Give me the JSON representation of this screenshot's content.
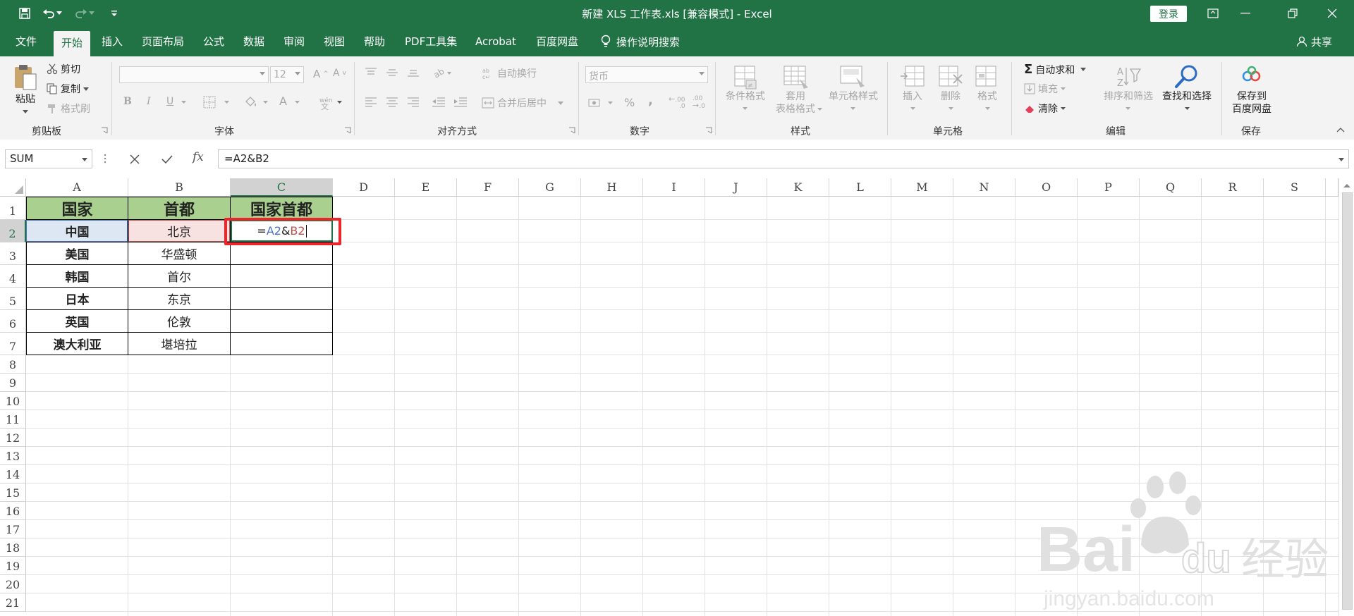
{
  "window": {
    "title": "新建 XLS 工作表.xls  [兼容模式]  -  Excel",
    "login_label": "登录"
  },
  "tabs": [
    {
      "label": "文件"
    },
    {
      "label": "开始"
    },
    {
      "label": "插入"
    },
    {
      "label": "页面布局"
    },
    {
      "label": "公式"
    },
    {
      "label": "数据"
    },
    {
      "label": "审阅"
    },
    {
      "label": "视图"
    },
    {
      "label": "帮助"
    },
    {
      "label": "PDF工具集"
    },
    {
      "label": "Acrobat"
    },
    {
      "label": "百度网盘"
    }
  ],
  "tell_me": "操作说明搜索",
  "share_label": "共享",
  "ribbon": {
    "clipboard": {
      "paste": "粘贴",
      "cut": "剪切",
      "copy": "复制",
      "format_painter": "格式刷",
      "group": "剪贴板"
    },
    "font": {
      "size": "12",
      "bold": "B",
      "italic": "I",
      "underline": "U",
      "group": "字体",
      "grow": "A",
      "shrink": "A",
      "color": "A"
    },
    "alignment": {
      "wrap": "自动换行",
      "merge": "合并后居中",
      "group": "对齐方式"
    },
    "number": {
      "format": "货币",
      "percent": "%",
      "comma": ",",
      "inc_decimal": ".00",
      "dec_decimal": ".00",
      "group": "数字"
    },
    "styles": {
      "conditional": "条件格式",
      "table_line1": "套用",
      "table_line2": "表格格式",
      "cell_styles": "单元格样式",
      "group": "样式"
    },
    "cells": {
      "insert": "插入",
      "delete": "删除",
      "format": "格式",
      "group": "单元格"
    },
    "editing": {
      "autosum": "自动求和",
      "fill": "填充",
      "clear": "清除",
      "sort": "排序和筛选",
      "find": "查找和选择",
      "group": "编辑"
    },
    "save": {
      "line1": "保存到",
      "line2": "百度网盘",
      "group": "保存"
    }
  },
  "formula_bar": {
    "name_box": "SUM",
    "formula": "=A2&B2",
    "fx": "fx"
  },
  "columns": [
    "A",
    "B",
    "C",
    "D",
    "E",
    "F",
    "G",
    "H",
    "I",
    "J",
    "K",
    "L",
    "M",
    "N",
    "O",
    "P",
    "Q",
    "R",
    "S"
  ],
  "rows": [
    "1",
    "2",
    "3",
    "4",
    "5",
    "6",
    "7",
    "8",
    "9",
    "10",
    "11",
    "12",
    "13",
    "14",
    "15",
    "16",
    "17",
    "18",
    "19",
    "20",
    "21"
  ],
  "table": {
    "headers": [
      "国家",
      "首都",
      "国家首都"
    ],
    "rows": [
      {
        "country": "中国",
        "capital": "北京"
      },
      {
        "country": "美国",
        "capital": "华盛顿"
      },
      {
        "country": "韩国",
        "capital": "首尔"
      },
      {
        "country": "日本",
        "capital": "东京"
      },
      {
        "country": "英国",
        "capital": "伦敦"
      },
      {
        "country": "澳大利亚",
        "capital": "堪培拉"
      }
    ]
  },
  "edit_cell": {
    "eq": "=",
    "ref1": "A2",
    "amp": "&",
    "ref2": "B2"
  },
  "watermark": {
    "brand": "Bai",
    "du": "du",
    "jy": "经验",
    "url": "jingyan.baidu.com"
  },
  "colors": {
    "excel_green": "#217346",
    "header_fill": "#a9d08e",
    "ref1": "#4472c4",
    "ref2": "#c0504d",
    "highlight": "#e8262c"
  }
}
